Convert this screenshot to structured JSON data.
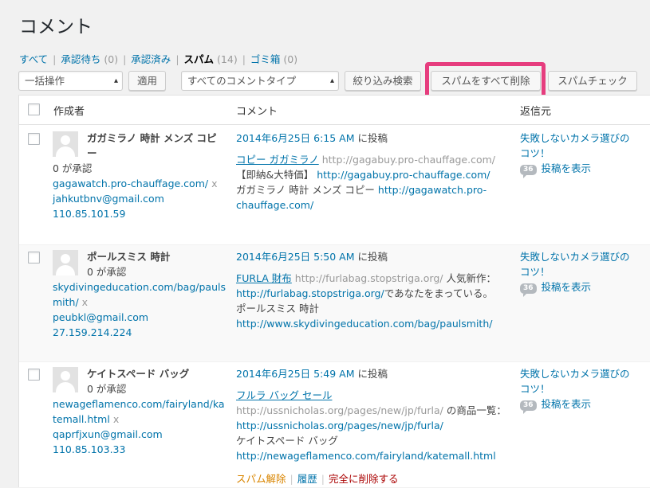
{
  "page_title": "コメント",
  "filters": {
    "all": "すべて",
    "pending": "承認待ち",
    "pending_count": "(0)",
    "approved": "承認済み",
    "spam": "スパム",
    "spam_count": "(14)",
    "trash": "ゴミ箱",
    "trash_count": "(0)"
  },
  "toolbar": {
    "bulk_action": "一括操作",
    "apply": "適用",
    "comment_type": "すべてのコメントタイプ",
    "filter": "絞り込み検索",
    "empty_spam": "スパムをすべて削除",
    "check_spam": "スパムチェック"
  },
  "columns": {
    "author": "作成者",
    "comment": "コメント",
    "response": "返信元"
  },
  "accent_color": "#e63d7e",
  "rows": [
    {
      "author_name_1": "ガガミラノ 時計 メンズ コピ",
      "author_name_2": "ー",
      "approved": "0 が承認",
      "url": "gagawatch.pro-chauffage.com/",
      "x": "x",
      "email": "jahkutbnv@gmail.com",
      "ip": "110.85.101.59",
      "submitted": "2014年6月25日 6:15 AM",
      "submitted_suffix": "に投稿",
      "text_1_link": "コピー ガガミラノ",
      "text_1_url": "http://gagabuy.pro-chauffage.com/",
      "text_2_plain": "【即納&大特価】",
      "text_2_url": "http://gagabuy.pro-chauffage.com/",
      "text_3_plain": "ガガミラノ 時計 メンズ コピー",
      "text_3_url": "http://gagawatch.pro-",
      "text_4_url": "chauffage.com/",
      "response_1": "失敗しないカメラ選びの",
      "response_2": "コツ！",
      "response_count": "36",
      "response_view": "投稿を表示"
    },
    {
      "author_name_1": "ポールスミス 時計",
      "approved": "0 が承認",
      "url_1": "skydivingeducation.com/bag/pauls",
      "url_2": "mith/",
      "x": "x",
      "email": "peubkl@gmail.com",
      "ip": "27.159.214.224",
      "submitted": "2014年6月25日 5:50 AM",
      "submitted_suffix": "に投稿",
      "text_1_link": "FURLA 財布",
      "text_1_url": "http://furlabag.stopstriga.org/",
      "text_1_plain": "人気新作：",
      "text_2_url": "http://furlabag.stopstriga.org/",
      "text_2_plain": "であなたをまっている。",
      "text_3_plain": "ポールスミス 時計",
      "text_4_url": "http://www.skydivingeducation.com/bag/paulsmith/",
      "response_1": "失敗しないカメラ選びの",
      "response_2": "コツ！",
      "response_count": "36",
      "response_view": "投稿を表示"
    },
    {
      "author_name_1": "ケイトスペード バッグ",
      "approved": "0 が承認",
      "url_1": "newageflamenco.com/fairyland/ka",
      "url_2": "temall.html",
      "x": "x",
      "email": "qaprfjxun@gmail.com",
      "ip": "110.85.103.33",
      "submitted": "2014年6月25日 5:49 AM",
      "submitted_suffix": "に投稿",
      "text_1_link": "フルラ バッグ セール",
      "text_2_url": "http://ussnicholas.org/pages/new/jp/furla/",
      "text_2_plain": "の商品一覧：",
      "text_3_url": "http://ussnicholas.org/pages/new/jp/furla/",
      "text_4_plain": "ケイトスペード バッグ",
      "text_5_url": "http://newageflamenco.com/fairyland/katemall.html",
      "response_1": "失敗しないカメラ選びの",
      "response_2": "コツ！",
      "response_count": "36",
      "response_view": "投稿を表示",
      "actions": {
        "not_spam": "スパム解除",
        "history": "履歴",
        "delete": "完全に削除する"
      }
    }
  ]
}
